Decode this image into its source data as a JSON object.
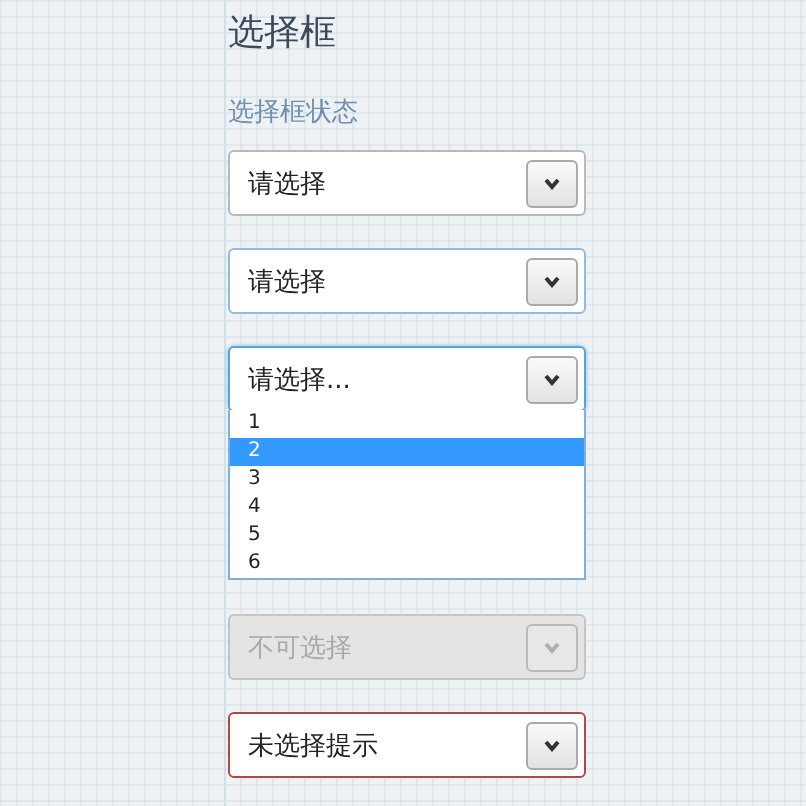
{
  "title": "选择框",
  "section": {
    "heading": "选择框状态",
    "selects": [
      {
        "kind": "default",
        "value": "请选择"
      },
      {
        "kind": "hover",
        "value": "请选择"
      },
      {
        "kind": "open",
        "value": "请选择...",
        "options": [
          {
            "label": "1",
            "selected": false
          },
          {
            "label": "2",
            "selected": true
          },
          {
            "label": "3",
            "selected": false
          },
          {
            "label": "4",
            "selected": false
          },
          {
            "label": "5",
            "selected": false
          },
          {
            "label": "6",
            "selected": false
          }
        ]
      },
      {
        "kind": "disabled",
        "value": "不可选择"
      },
      {
        "kind": "error",
        "value": "未选择提示"
      }
    ]
  }
}
